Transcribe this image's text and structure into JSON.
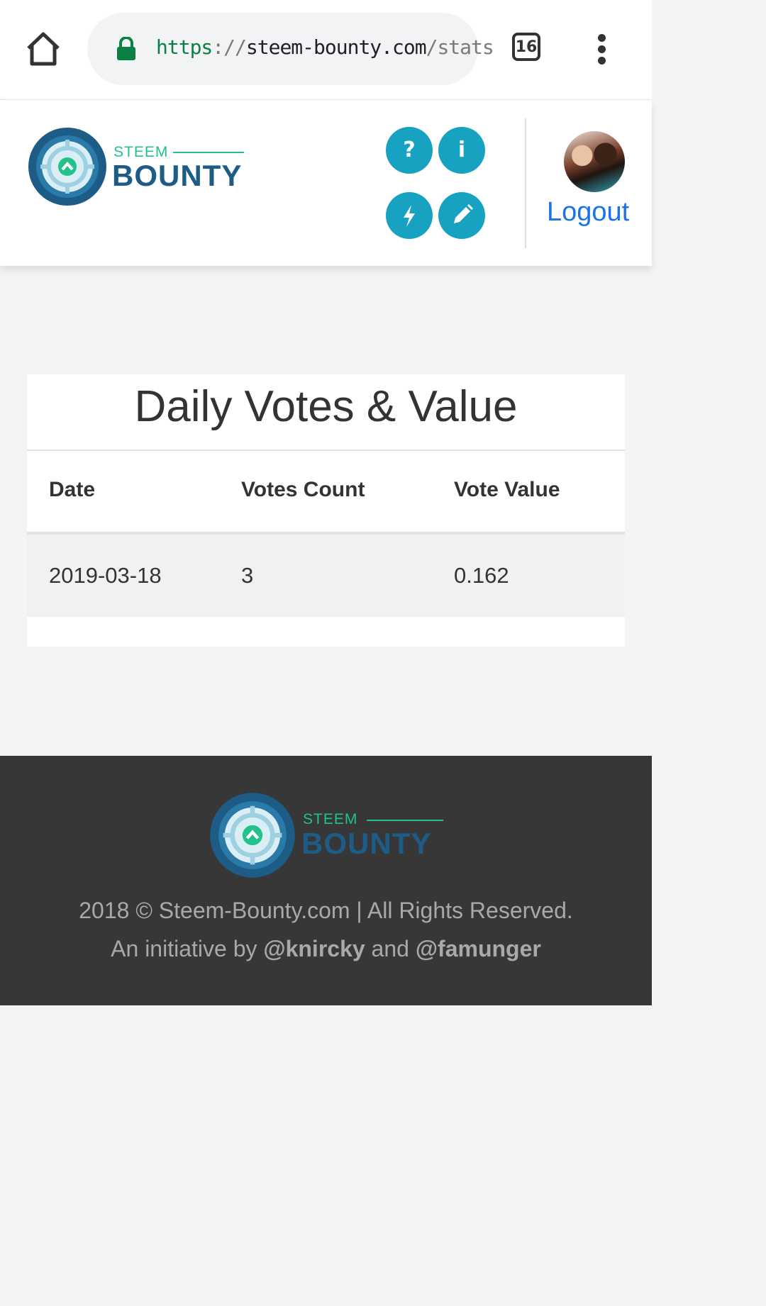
{
  "browser": {
    "url_scheme": "https",
    "url_sep": "://",
    "url_host": "steem-bounty.com",
    "url_path": "/stats",
    "tab_count": "16"
  },
  "header": {
    "logo_top": "STEEM",
    "logo_main": "BOUNTY",
    "buttons": [
      "?",
      "i"
    ],
    "logout_label": "Logout"
  },
  "stats": {
    "title": "Daily Votes & Value",
    "columns": [
      "Date",
      "Votes Count",
      "Vote Value"
    ],
    "rows": [
      [
        "2019-03-18",
        "3",
        "0.162"
      ]
    ]
  },
  "footer": {
    "logo_top": "STEEM",
    "logo_main": "BOUNTY",
    "copyright": "2018 © Steem-Bounty.com | All Rights Reserved.",
    "initiative_prefix": "An initiative by",
    "author1": "@knircky",
    "conjunction": "and",
    "author2": "@famunger"
  },
  "colors": {
    "accent": "#17a2c2",
    "logo_green": "#22c28a",
    "logo_blue": "#1d5c86",
    "link_blue": "#1a73e8",
    "footer_bg": "#373737"
  }
}
